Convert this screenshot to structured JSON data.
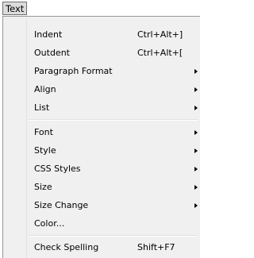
{
  "menubar": {
    "text_label": "Text"
  },
  "menu": {
    "items": [
      {
        "label": "Indent",
        "shortcut": "Ctrl+Alt+]"
      },
      {
        "label": "Outdent",
        "shortcut": "Ctrl+Alt+["
      },
      {
        "label": "Paragraph Format",
        "submenu": true
      },
      {
        "label": "Align",
        "submenu": true
      },
      {
        "label": "List",
        "submenu": true
      },
      {
        "label": "Font",
        "submenu": true
      },
      {
        "label": "Style",
        "submenu": true
      },
      {
        "label": "CSS Styles",
        "submenu": true
      },
      {
        "label": "Size",
        "submenu": true
      },
      {
        "label": "Size Change",
        "submenu": true
      },
      {
        "label": "Color..."
      },
      {
        "label": "Check Spelling",
        "shortcut": "Shift+F7"
      }
    ]
  },
  "colors": {
    "menu_background": "#f0f0f0",
    "active_menubar_item": "#dcdcdc",
    "border": "#979797"
  }
}
